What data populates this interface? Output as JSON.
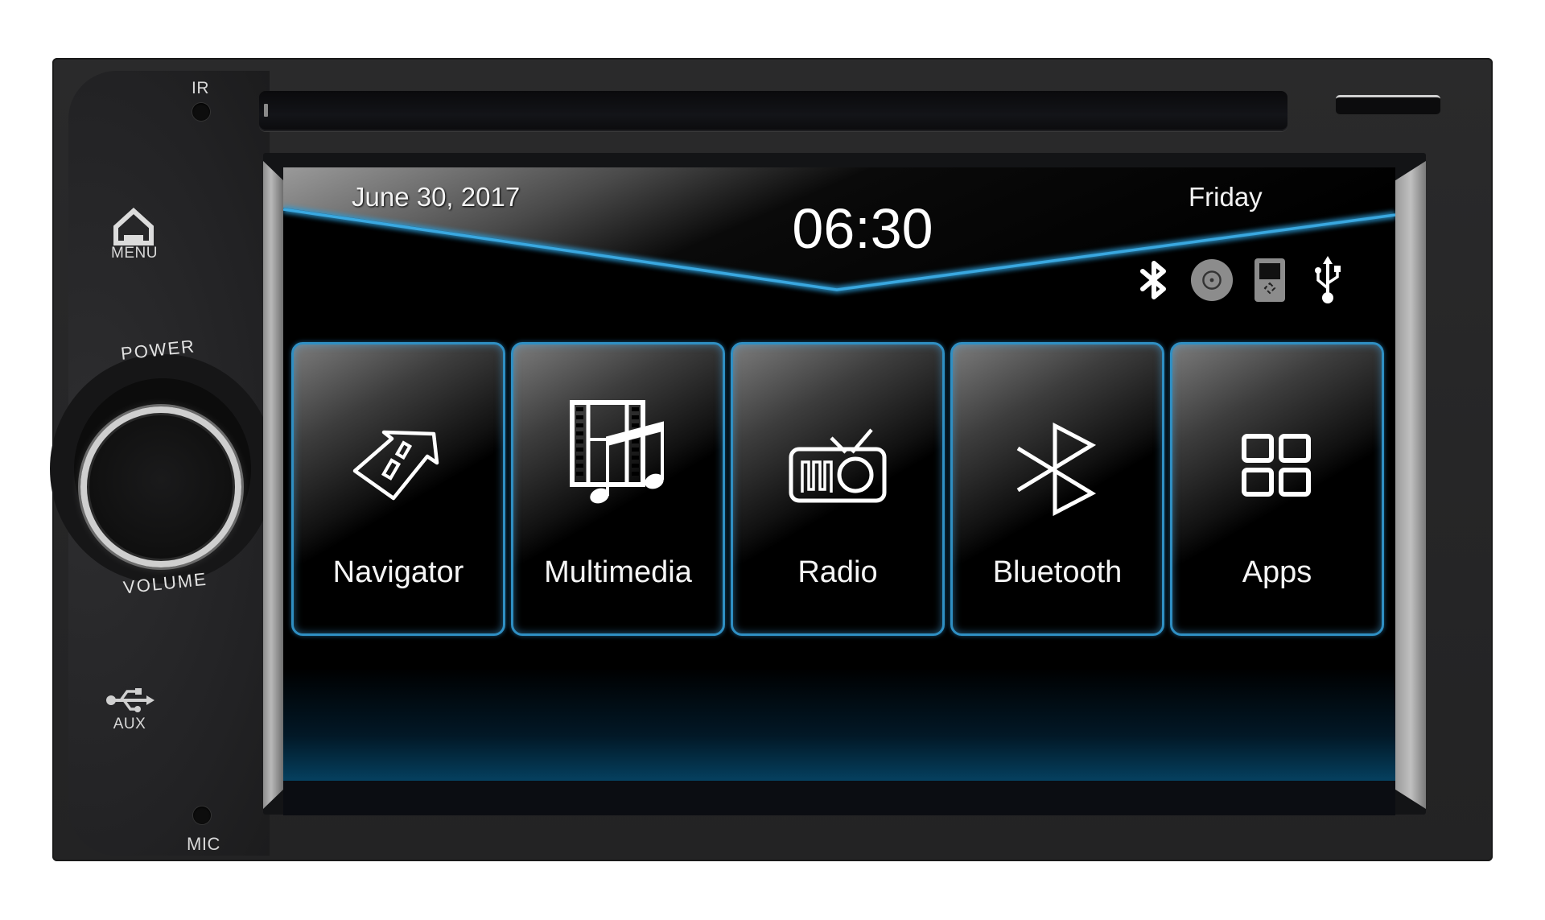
{
  "device": {
    "panel_labels": {
      "ir": "IR",
      "menu": "MENU",
      "power": "POWER",
      "volume": "VOLUME",
      "aux": "AUX",
      "mic": "MIC"
    },
    "panel_icons": {
      "menu": "home-icon",
      "aux": "usb-icon"
    }
  },
  "screen": {
    "header": {
      "date": "June 30, 2017",
      "time": "06:30",
      "day": "Friday"
    },
    "status_icons": [
      {
        "name": "bluetooth-icon",
        "state": "active",
        "color": "#ffffff"
      },
      {
        "name": "disc-icon",
        "state": "inactive",
        "color": "#8c8c8c"
      },
      {
        "name": "ipod-icon",
        "state": "inactive",
        "color": "#8c8c8c"
      },
      {
        "name": "usb-icon",
        "state": "active",
        "color": "#ffffff"
      }
    ],
    "tiles": [
      {
        "label": "Navigator",
        "icon": "navigation-arrow-icon"
      },
      {
        "label": "Multimedia",
        "icon": "film-music-icon"
      },
      {
        "label": "Radio",
        "icon": "radio-icon"
      },
      {
        "label": "Bluetooth",
        "icon": "bluetooth-icon"
      },
      {
        "label": "Apps",
        "icon": "apps-grid-icon"
      }
    ]
  },
  "colors": {
    "accent": "#2f8fc3",
    "text": "#ffffff",
    "background": "#000000"
  }
}
